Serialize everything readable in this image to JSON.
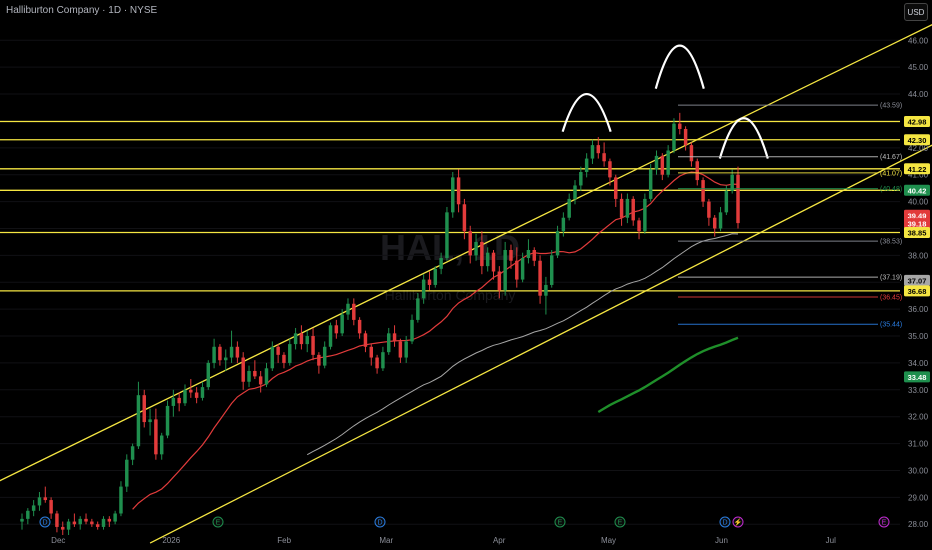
{
  "header": {
    "title": "Halliburton Company · 1D · NYSE"
  },
  "currency_button": "USD",
  "watermark": {
    "symbol": "HAL, 1D",
    "name": "Halliburton Company"
  },
  "colors": {
    "up": "#1f8f4e",
    "down": "#e23b3b",
    "hline": "#f5e642",
    "ma_red": "#e23b3b",
    "ma_gray": "#a6a6a6",
    "ma_green": "#1f8f2a",
    "blue": "#2a7de1"
  },
  "chart_data": {
    "type": "candlestick",
    "ylim": [
      27.6,
      47.2
    ],
    "y_ticks": [
      "28.00",
      "29.00",
      "30.00",
      "31.00",
      "32.00",
      "33.00",
      "34.00",
      "35.00",
      "36.00",
      "37.00",
      "38.00",
      "39.00",
      "40.00",
      "41.00",
      "42.00",
      "43.00",
      "44.00",
      "45.00",
      "46.00"
    ],
    "x_ticks": [
      "Dec",
      "2026",
      "Feb",
      "Mar",
      "Apr",
      "May",
      "Jun",
      "Jul"
    ],
    "horizontal_levels": [
      42.98,
      42.3,
      41.22,
      40.42,
      38.85,
      36.68
    ],
    "level_tags": [
      {
        "value": "42.98",
        "kind": "hline"
      },
      {
        "value": "42.30",
        "kind": "hline"
      },
      {
        "value": "41.22",
        "kind": "hline"
      },
      {
        "value": "40.42",
        "kind": "green"
      },
      {
        "value": "39.49",
        "kind": "red"
      },
      {
        "value": "39.18",
        "kind": "red"
      },
      {
        "value": "38.85",
        "kind": "hline"
      },
      {
        "value": "37.07",
        "kind": "gray"
      },
      {
        "value": "36.68",
        "kind": "hline"
      },
      {
        "value": "33.48",
        "kind": "green"
      }
    ],
    "fib_labels": [
      {
        "label": "(43.59)",
        "value": 43.59,
        "color": "#8c8f99"
      },
      {
        "label": "(41.67)",
        "value": 41.67,
        "color": "#bfbfbf"
      },
      {
        "label": "(41.07)",
        "value": 41.07,
        "color": "#f5e642"
      },
      {
        "label": "(40.48)",
        "value": 40.48,
        "color": "#1f8f4e"
      },
      {
        "label": "(38.53)",
        "value": 38.53,
        "color": "#8c8f99"
      },
      {
        "label": "(37.19)",
        "value": 37.19,
        "color": "#bfbfbf"
      },
      {
        "label": "(36.45)",
        "value": 36.45,
        "color": "#e23b3b"
      },
      {
        "label": "(35.44)",
        "value": 35.44,
        "color": "#2a7de1"
      }
    ],
    "candles": [
      [
        28.1,
        28.4,
        27.8,
        28.2
      ],
      [
        28.2,
        28.6,
        28.0,
        28.5
      ],
      [
        28.5,
        28.9,
        28.3,
        28.7
      ],
      [
        28.7,
        29.2,
        28.5,
        29.0
      ],
      [
        29.0,
        29.4,
        28.8,
        28.9
      ],
      [
        28.9,
        29.0,
        28.2,
        28.4
      ],
      [
        28.4,
        28.5,
        27.7,
        27.9
      ],
      [
        27.9,
        28.1,
        27.6,
        27.8
      ],
      [
        27.8,
        28.2,
        27.6,
        28.1
      ],
      [
        28.1,
        28.4,
        27.9,
        28.0
      ],
      [
        28.0,
        28.3,
        27.8,
        28.2
      ],
      [
        28.2,
        28.4,
        28.0,
        28.1
      ],
      [
        28.1,
        28.2,
        27.9,
        28.0
      ],
      [
        28.0,
        28.1,
        27.8,
        27.9
      ],
      [
        27.9,
        28.3,
        27.8,
        28.2
      ],
      [
        28.2,
        28.3,
        27.9,
        28.1
      ],
      [
        28.1,
        28.5,
        28.0,
        28.4
      ],
      [
        28.4,
        29.6,
        28.3,
        29.4
      ],
      [
        29.4,
        30.6,
        29.2,
        30.4
      ],
      [
        30.4,
        31.0,
        30.2,
        30.9
      ],
      [
        30.9,
        33.3,
        30.8,
        32.8
      ],
      [
        32.8,
        33.0,
        31.6,
        31.8
      ],
      [
        31.8,
        32.3,
        31.3,
        31.9
      ],
      [
        31.9,
        32.3,
        30.4,
        30.6
      ],
      [
        30.6,
        31.4,
        30.4,
        31.3
      ],
      [
        31.3,
        32.6,
        31.2,
        32.4
      ],
      [
        32.4,
        33.0,
        32.0,
        32.7
      ],
      [
        32.7,
        32.9,
        32.2,
        32.5
      ],
      [
        32.5,
        33.2,
        32.4,
        33.0
      ],
      [
        33.0,
        33.4,
        32.7,
        32.9
      ],
      [
        32.9,
        33.1,
        32.5,
        32.7
      ],
      [
        32.7,
        33.3,
        32.6,
        33.1
      ],
      [
        33.1,
        34.1,
        33.0,
        34.0
      ],
      [
        34.0,
        34.9,
        33.8,
        34.6
      ],
      [
        34.6,
        34.7,
        33.9,
        34.1
      ],
      [
        34.1,
        34.5,
        33.7,
        34.2
      ],
      [
        34.2,
        35.2,
        34.0,
        34.6
      ],
      [
        34.6,
        34.8,
        34.0,
        34.2
      ],
      [
        34.2,
        34.4,
        33.0,
        33.3
      ],
      [
        33.3,
        33.9,
        33.1,
        33.7
      ],
      [
        33.7,
        34.1,
        33.4,
        33.5
      ],
      [
        33.5,
        33.7,
        32.9,
        33.2
      ],
      [
        33.2,
        34.0,
        33.1,
        33.8
      ],
      [
        33.8,
        34.8,
        33.7,
        34.6
      ],
      [
        34.6,
        34.7,
        34.0,
        34.3
      ],
      [
        34.3,
        34.4,
        33.8,
        34.0
      ],
      [
        34.0,
        34.9,
        33.9,
        34.7
      ],
      [
        34.7,
        35.3,
        34.5,
        35.1
      ],
      [
        35.1,
        35.4,
        34.5,
        34.7
      ],
      [
        34.7,
        35.2,
        34.4,
        35.0
      ],
      [
        35.0,
        35.3,
        34.1,
        34.3
      ],
      [
        34.3,
        34.4,
        33.6,
        33.9
      ],
      [
        33.9,
        34.8,
        33.8,
        34.6
      ],
      [
        34.6,
        35.5,
        34.5,
        35.4
      ],
      [
        35.4,
        35.6,
        34.9,
        35.1
      ],
      [
        35.1,
        36.0,
        35.0,
        35.8
      ],
      [
        35.8,
        36.4,
        35.6,
        36.2
      ],
      [
        36.2,
        36.4,
        35.4,
        35.6
      ],
      [
        35.6,
        35.7,
        34.9,
        35.1
      ],
      [
        35.1,
        35.2,
        34.4,
        34.6
      ],
      [
        34.6,
        34.7,
        33.9,
        34.2
      ],
      [
        34.2,
        34.3,
        33.6,
        33.8
      ],
      [
        33.8,
        34.6,
        33.7,
        34.4
      ],
      [
        34.4,
        35.3,
        34.3,
        35.1
      ],
      [
        35.1,
        35.4,
        34.6,
        34.8
      ],
      [
        34.8,
        34.9,
        34.0,
        34.2
      ],
      [
        34.2,
        35.0,
        34.0,
        34.8
      ],
      [
        34.8,
        35.8,
        34.7,
        35.6
      ],
      [
        35.6,
        36.6,
        35.5,
        36.4
      ],
      [
        36.4,
        37.3,
        36.2,
        37.1
      ],
      [
        37.1,
        37.4,
        36.7,
        36.9
      ],
      [
        36.9,
        37.6,
        36.8,
        37.5
      ],
      [
        37.5,
        38.1,
        37.3,
        37.9
      ],
      [
        37.9,
        39.8,
        37.8,
        39.6
      ],
      [
        39.6,
        41.1,
        39.4,
        40.9
      ],
      [
        40.9,
        41.2,
        39.6,
        39.9
      ],
      [
        39.9,
        40.1,
        38.6,
        38.9
      ],
      [
        38.9,
        39.1,
        37.7,
        38.0
      ],
      [
        38.0,
        38.8,
        37.8,
        38.5
      ],
      [
        38.5,
        38.9,
        37.3,
        37.6
      ],
      [
        37.6,
        38.3,
        37.4,
        38.1
      ],
      [
        38.1,
        38.2,
        37.1,
        37.4
      ],
      [
        37.4,
        37.6,
        36.4,
        36.7
      ],
      [
        36.7,
        38.5,
        36.5,
        38.2
      ],
      [
        38.2,
        38.4,
        37.5,
        37.8
      ],
      [
        37.8,
        38.3,
        36.8,
        37.1
      ],
      [
        37.1,
        38.1,
        37.0,
        37.9
      ],
      [
        37.9,
        38.6,
        37.7,
        38.2
      ],
      [
        38.2,
        38.3,
        37.6,
        37.8
      ],
      [
        37.8,
        38.0,
        36.2,
        36.5
      ],
      [
        36.5,
        37.2,
        35.8,
        36.9
      ],
      [
        36.9,
        38.2,
        36.8,
        38.0
      ],
      [
        38.0,
        39.1,
        37.9,
        38.9
      ],
      [
        38.9,
        39.6,
        38.7,
        39.4
      ],
      [
        39.4,
        40.3,
        39.3,
        40.1
      ],
      [
        40.1,
        40.8,
        39.9,
        40.6
      ],
      [
        40.6,
        41.3,
        40.4,
        41.1
      ],
      [
        41.1,
        41.8,
        40.9,
        41.6
      ],
      [
        41.6,
        42.3,
        41.4,
        42.1
      ],
      [
        42.1,
        42.4,
        41.6,
        41.8
      ],
      [
        41.8,
        42.2,
        41.3,
        41.5
      ],
      [
        41.5,
        41.6,
        40.6,
        40.9
      ],
      [
        40.9,
        41.0,
        39.8,
        40.1
      ],
      [
        40.1,
        40.3,
        39.1,
        39.4
      ],
      [
        39.4,
        40.3,
        39.2,
        40.1
      ],
      [
        40.1,
        40.2,
        39.1,
        39.3
      ],
      [
        39.3,
        39.4,
        38.6,
        38.9
      ],
      [
        38.9,
        40.3,
        38.8,
        40.1
      ],
      [
        40.1,
        41.4,
        40.0,
        41.2
      ],
      [
        41.2,
        41.9,
        41.0,
        41.7
      ],
      [
        41.7,
        41.8,
        40.8,
        41.0
      ],
      [
        41.0,
        42.1,
        40.9,
        41.9
      ],
      [
        41.9,
        43.1,
        41.8,
        42.9
      ],
      [
        42.9,
        43.3,
        42.5,
        42.7
      ],
      [
        42.7,
        42.8,
        41.9,
        42.1
      ],
      [
        42.1,
        42.2,
        41.3,
        41.5
      ],
      [
        41.5,
        41.6,
        40.6,
        40.8
      ],
      [
        40.8,
        40.9,
        39.8,
        40.0
      ],
      [
        40.0,
        40.1,
        39.1,
        39.4
      ],
      [
        39.4,
        39.5,
        38.7,
        39.0
      ],
      [
        39.0,
        39.8,
        38.9,
        39.6
      ],
      [
        39.6,
        40.6,
        39.5,
        40.4
      ],
      [
        40.4,
        41.2,
        40.3,
        41.0
      ],
      [
        41.0,
        41.3,
        39.0,
        39.2
      ]
    ]
  },
  "x_range": {
    "start_date": "Nov 15",
    "end_date": "Jul 20"
  },
  "event_markers": [
    {
      "glyph": "D",
      "color": "#2a7de1"
    },
    {
      "glyph": "E",
      "color": "#1f8f4e"
    },
    {
      "glyph": "D",
      "color": "#2a7de1"
    },
    {
      "glyph": "E",
      "color": "#1f8f4e"
    },
    {
      "glyph": "E",
      "color": "#1f8f4e"
    },
    {
      "glyph": "D",
      "color": "#2a7de1"
    },
    {
      "glyph": "⚡",
      "color": "#c02bd1"
    },
    {
      "glyph": "E",
      "color": "#c02bd1"
    }
  ]
}
